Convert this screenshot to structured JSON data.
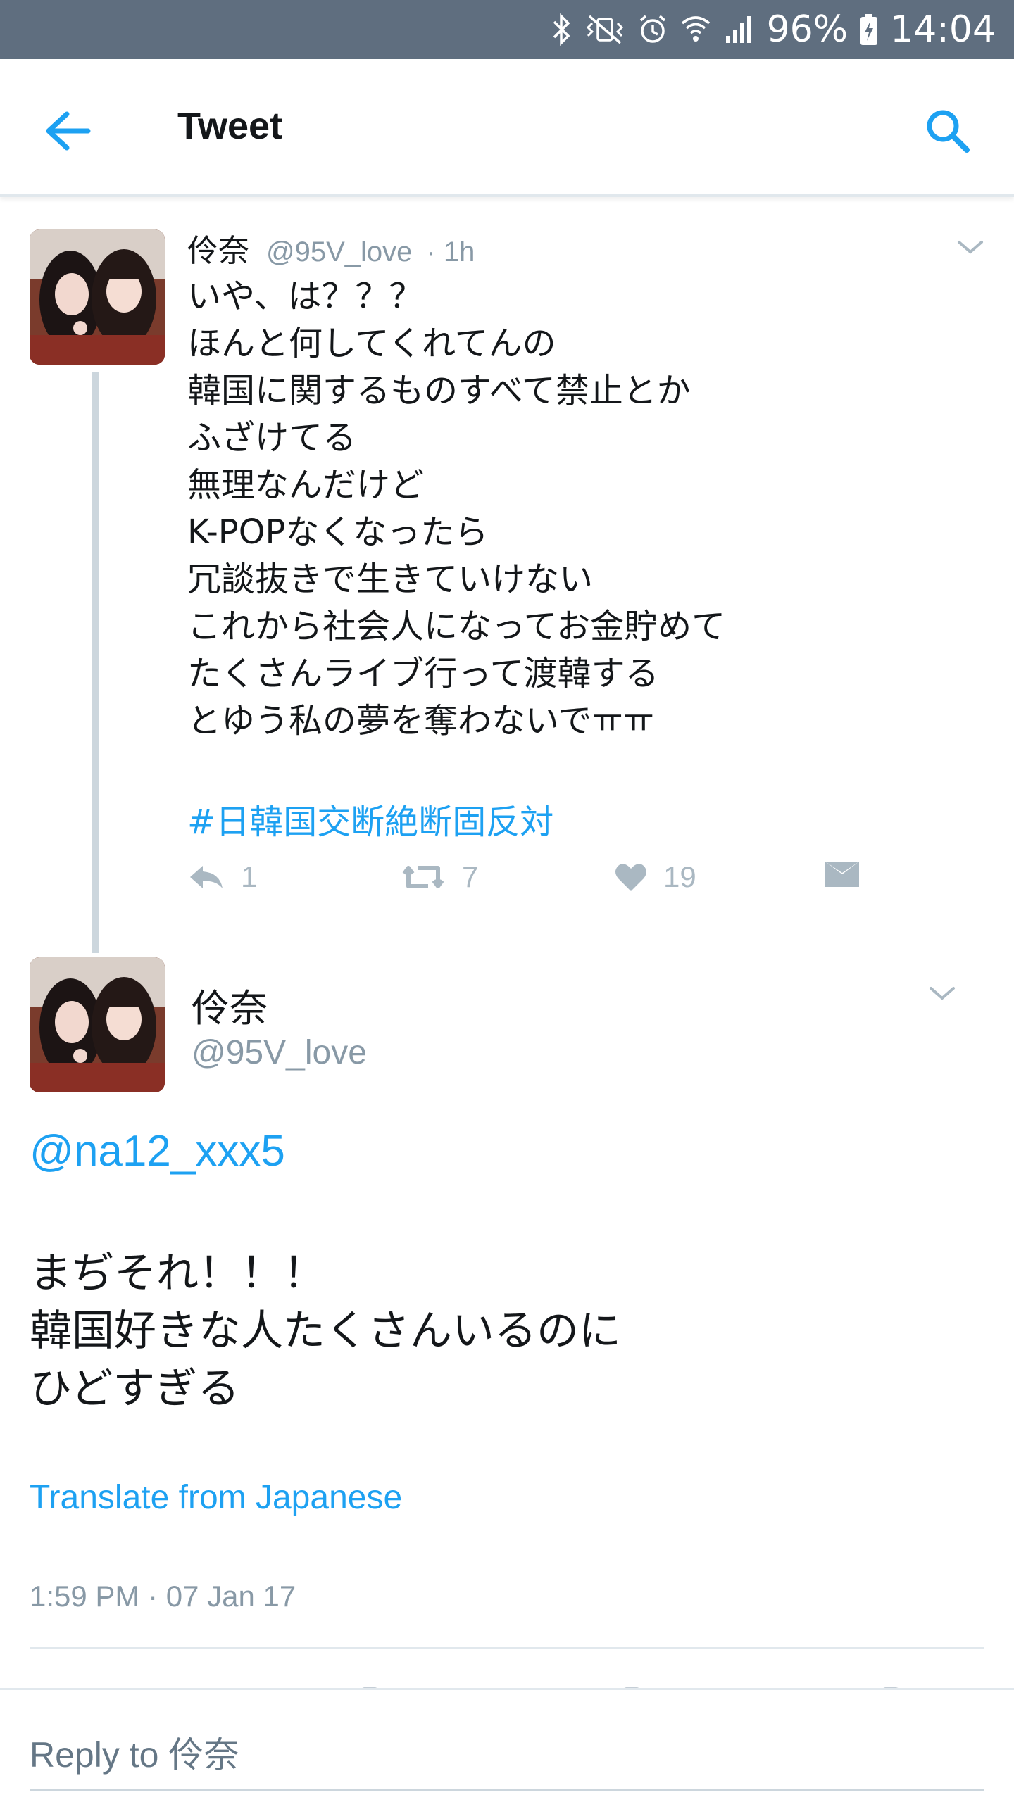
{
  "status_bar": {
    "battery": "96%",
    "time": "14:04",
    "icons": [
      "bluetooth-icon",
      "vibrate-mute-icon",
      "alarm-icon",
      "wifi-icon",
      "signal-icon",
      "battery-charging-icon"
    ]
  },
  "header": {
    "title": "Tweet",
    "back_icon": "arrow-left-icon",
    "search_icon": "search-icon"
  },
  "parent_tweet": {
    "name": "伶奈",
    "handle": "@95V_love",
    "time_ago": "· 1h",
    "lines": [
      "いや、は？？？",
      "ほんと何してくれてんの",
      "韓国に関するものすべて禁止とか",
      "ふざけてる",
      "無理なんだけど",
      "K-POPなくなったら",
      "冗談抜きで生きていけない",
      "これから社会人になってお金貯めて",
      "たくさんライブ行って渡韓する",
      "とゆう私の夢を奪わないでㅠㅠ"
    ],
    "hashtag": "#日韓国交断絶断固反対",
    "actions": {
      "reply_count": "1",
      "retweet_count": "7",
      "like_count": "19"
    }
  },
  "main_tweet": {
    "name": "伶奈",
    "handle": "@95V_love",
    "mention": "@na12_xxx5",
    "lines": [
      "まぢそれ！！！",
      "韓国好きな人たくさんいるのに",
      "ひどすぎる"
    ],
    "translate_label": "Translate from Japanese",
    "timestamp": "1:59 PM · 07 Jan 17"
  },
  "reply_bar": {
    "placeholder": "Reply to 伶奈"
  },
  "colors": {
    "accent": "#1da1f2",
    "status_bar": "#5f6e7f",
    "muted": "#8899a6",
    "action_icon": "#aab8c2"
  }
}
